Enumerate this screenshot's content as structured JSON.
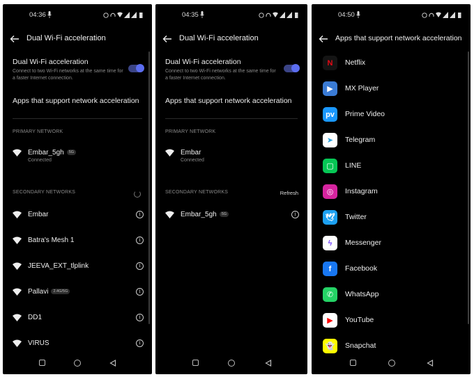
{
  "screens": [
    {
      "status_time": "04:36",
      "title": "Dual Wi-Fi acceleration",
      "toggle_title": "Dual Wi-Fi acceleration",
      "toggle_subtitle": "Connect to two Wi-Fi networks at the same time for a faster Internet connection.",
      "toggle_on": true,
      "apps_link": "Apps that support network acceleration",
      "primary_header": "PRIMARY NETWORK",
      "primary": {
        "name": "Embar_5gh",
        "badge": "5G",
        "status": "Connected"
      },
      "secondary_header": "SECONDARY NETWORKS",
      "secondary": [
        {
          "name": "Embar",
          "badge": ""
        },
        {
          "name": "Batra's Mesh 1",
          "badge": ""
        },
        {
          "name": "JEEVA_EXT_tlplink",
          "badge": ""
        },
        {
          "name": "Pallavi",
          "badge": "2.4G/5G"
        },
        {
          "name": "DD1",
          "badge": ""
        },
        {
          "name": "VIRUS",
          "badge": ""
        }
      ]
    },
    {
      "status_time": "04:35",
      "title": "Dual Wi-Fi acceleration",
      "toggle_title": "Dual Wi-Fi acceleration",
      "toggle_subtitle": "Connect to two Wi-Fi networks at the same time for a faster Internet connection.",
      "toggle_on": true,
      "apps_link": "Apps that support network acceleration",
      "primary_header": "PRIMARY NETWORK",
      "primary": {
        "name": "Embar",
        "badge": "",
        "status": "Connected"
      },
      "secondary_header": "SECONDARY NETWORKS",
      "refresh_label": "Refresh",
      "secondary": [
        {
          "name": "Embar_5gh",
          "badge": "5G"
        }
      ]
    },
    {
      "status_time": "04:50",
      "title": "Apps that support network acceleration",
      "apps": [
        {
          "name": "Netflix",
          "icon": "netflix-icon",
          "glyph": "N",
          "bg": "#141414",
          "fg": "#e50914"
        },
        {
          "name": "MX Player",
          "icon": "mx-player-icon",
          "glyph": "▶",
          "bg": "#3a7bd5",
          "fg": "#ffffff"
        },
        {
          "name": "Prime Video",
          "icon": "prime-video-icon",
          "glyph": "pv",
          "bg": "#1a98ff",
          "fg": "#ffffff"
        },
        {
          "name": "Telegram",
          "icon": "telegram-icon",
          "glyph": "➤",
          "bg": "#ffffff",
          "fg": "#2aa3df"
        },
        {
          "name": "LINE",
          "icon": "line-icon",
          "glyph": "▢",
          "bg": "#06c755",
          "fg": "#ffffff"
        },
        {
          "name": "Instagram",
          "icon": "instagram-icon",
          "glyph": "◎",
          "bg": "#d6249f",
          "fg": "#ffffff"
        },
        {
          "name": "Twitter",
          "icon": "twitter-icon",
          "glyph": "🕊",
          "bg": "#1da1f2",
          "fg": "#ffffff"
        },
        {
          "name": "Messenger",
          "icon": "messenger-icon",
          "glyph": "ϟ",
          "bg": "#ffffff",
          "fg": "#7b4dff"
        },
        {
          "name": "Facebook",
          "icon": "facebook-icon",
          "glyph": "f",
          "bg": "#1877f2",
          "fg": "#ffffff"
        },
        {
          "name": "WhatsApp",
          "icon": "whatsapp-icon",
          "glyph": "✆",
          "bg": "#25d366",
          "fg": "#ffffff"
        },
        {
          "name": "YouTube",
          "icon": "youtube-icon",
          "glyph": "▶",
          "bg": "#ffffff",
          "fg": "#ff0000"
        },
        {
          "name": "Snapchat",
          "icon": "snapchat-icon",
          "glyph": "👻",
          "bg": "#fffc00",
          "fg": "#ffffff"
        }
      ]
    }
  ]
}
